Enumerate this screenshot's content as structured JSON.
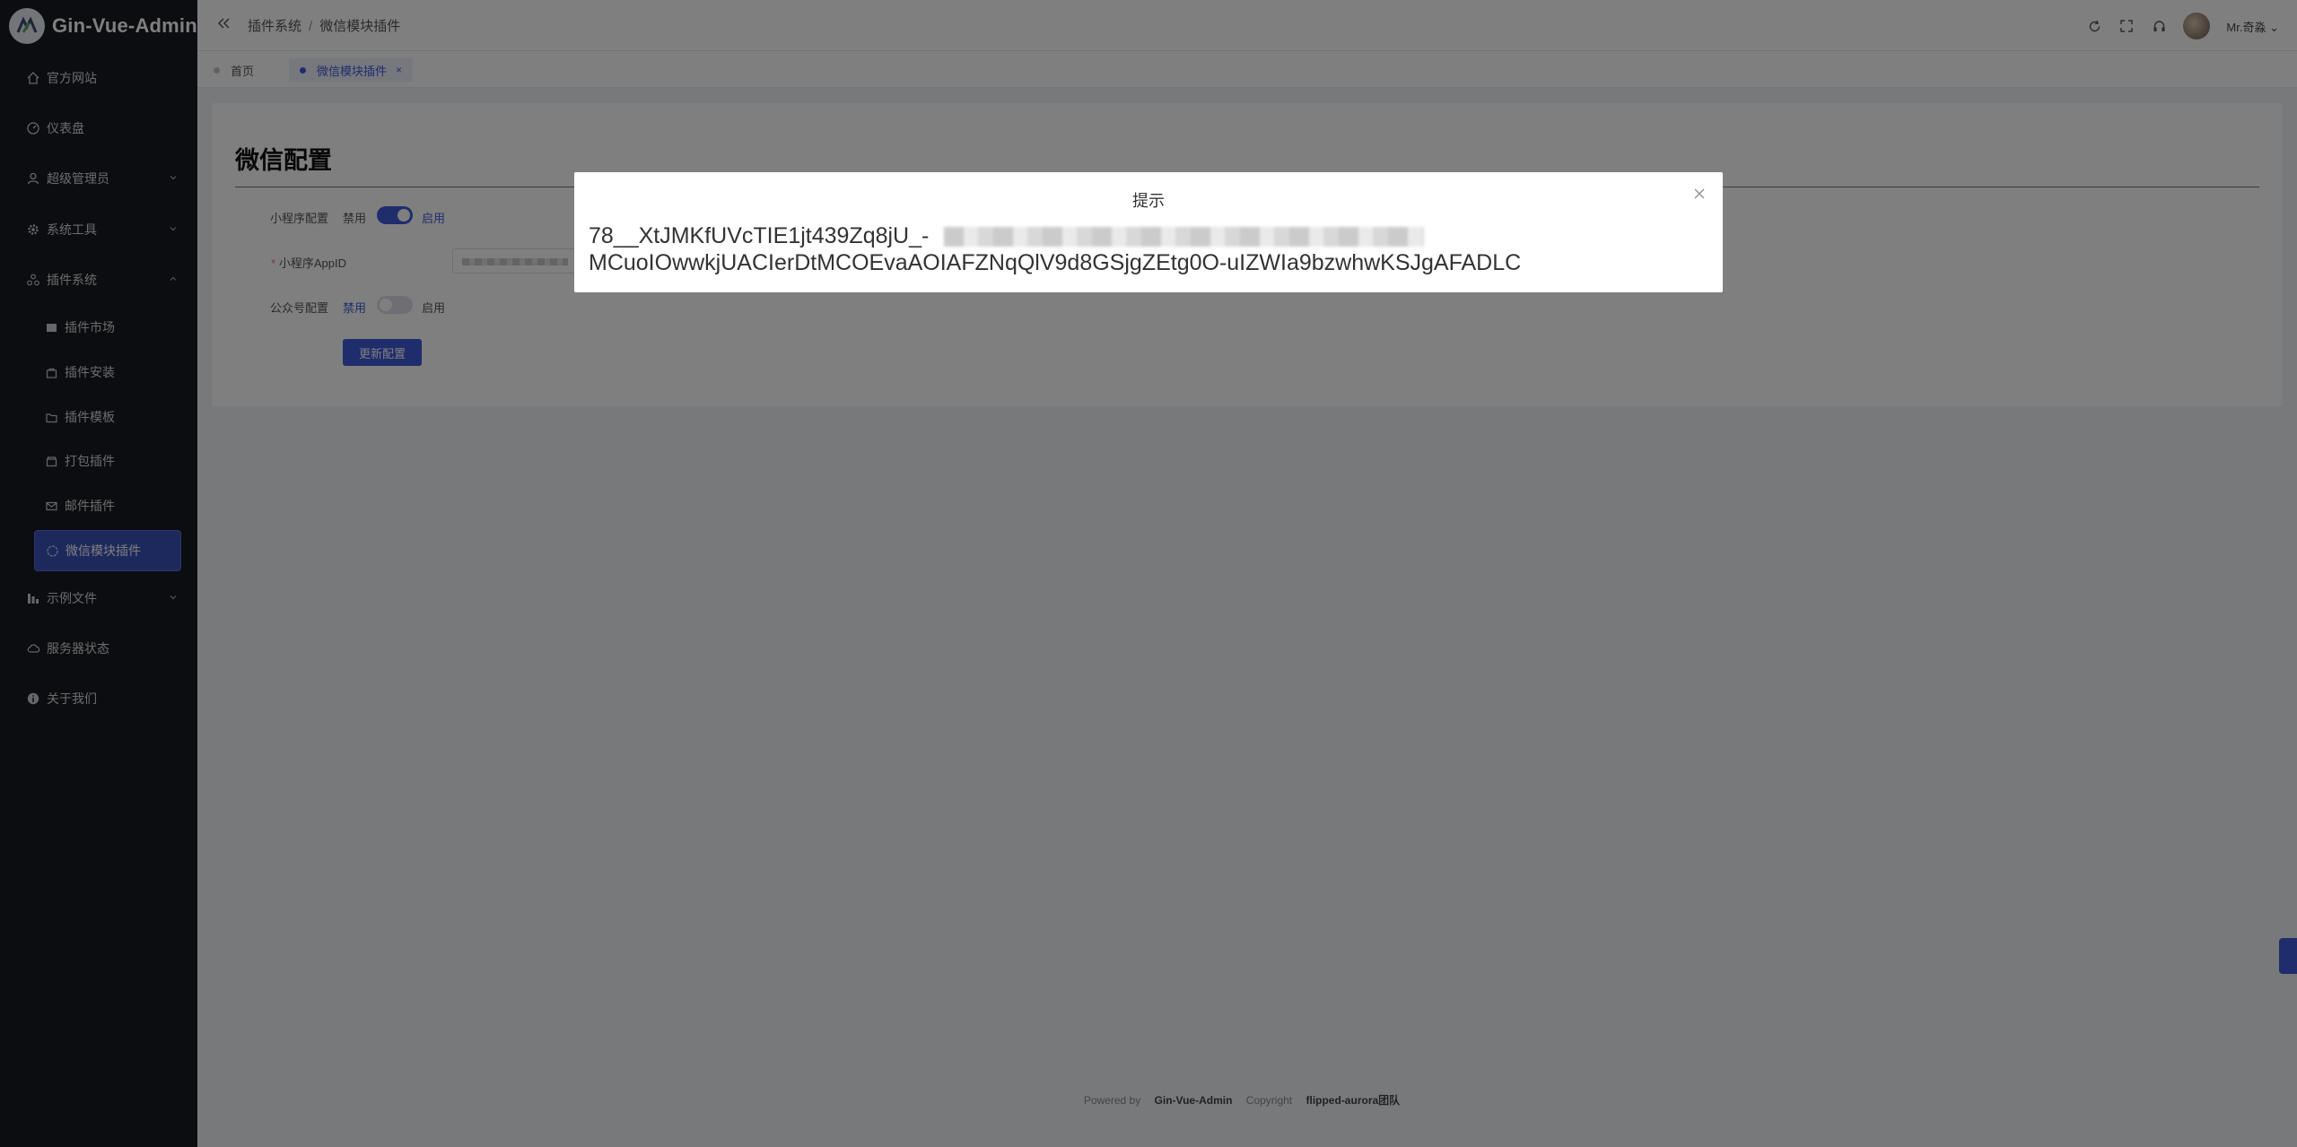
{
  "brand": {
    "name": "Gin-Vue-Admin"
  },
  "sidebar": {
    "items": [
      {
        "label": "官方网站",
        "icon": "home-icon"
      },
      {
        "label": "仪表盘",
        "icon": "dashboard-icon"
      },
      {
        "label": "超级管理员",
        "icon": "user-icon",
        "expandable": true
      },
      {
        "label": "系统工具",
        "icon": "gear-icon",
        "expandable": true
      },
      {
        "label": "插件系统",
        "icon": "cluster-icon",
        "expandable": true,
        "expanded": true
      },
      {
        "label": "插件市场",
        "icon": "shop-icon",
        "sub": true
      },
      {
        "label": "插件安装",
        "icon": "bag-icon",
        "sub": true
      },
      {
        "label": "插件模板",
        "icon": "folder-icon",
        "sub": true
      },
      {
        "label": "打包插件",
        "icon": "box-icon",
        "sub": true
      },
      {
        "label": "邮件插件",
        "icon": "mail-icon",
        "sub": true
      },
      {
        "label": "微信模块插件",
        "icon": "chat-icon",
        "sub": true,
        "active": true
      },
      {
        "label": "示例文件",
        "icon": "chart-icon",
        "expandable": true
      },
      {
        "label": "服务器状态",
        "icon": "cloud-icon"
      },
      {
        "label": "关于我们",
        "icon": "info-icon"
      }
    ]
  },
  "header": {
    "breadcrumb": [
      "插件系统",
      "微信模块插件"
    ],
    "user_name": "Mr.奇淼"
  },
  "tabs": [
    {
      "label": "首页",
      "active": false
    },
    {
      "label": "微信模块插件",
      "active": true,
      "close": "×"
    }
  ],
  "page": {
    "title": "微信配置",
    "form": {
      "mini_program": {
        "label": "小程序配置",
        "off": "禁用",
        "on": "启用",
        "enabled": true
      },
      "appid": {
        "label": "小程序AppID",
        "required_mark": "*"
      },
      "official_account": {
        "label": "公众号配置",
        "off": "禁用",
        "on": "启用",
        "enabled": false
      },
      "submit": "更新配置"
    }
  },
  "footer": {
    "powered_by": "Powered by",
    "project": "Gin-Vue-Admin",
    "copyright": "Copyright",
    "team": "flipped-aurora团队"
  },
  "dialog": {
    "title": "提示",
    "message_line1": "78__XtJMKfUVcTIE1jt439Zq8jU_-",
    "message_line2": "MCuoIOwwkjUACIerDtMCOEvaAOIAFZNqQlV9d8GSjgZEtg0O-uIZWIa9bzwhwKSJgAFADLC"
  },
  "colors": {
    "sidebar_bg": "#191a23",
    "accent": "#3f5ad8"
  }
}
